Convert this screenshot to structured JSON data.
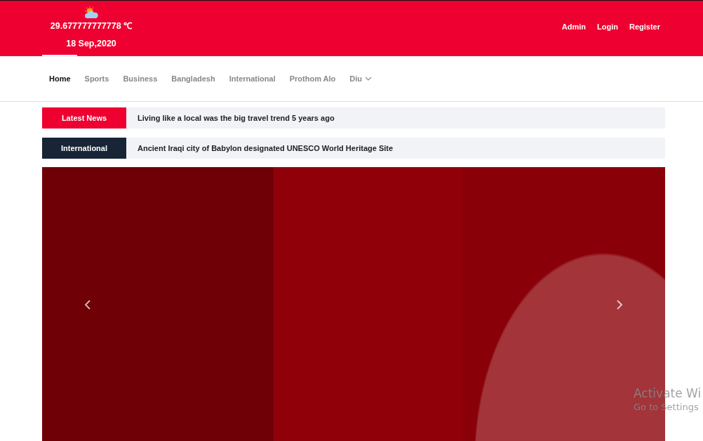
{
  "header": {
    "weather": {
      "temperature": "29.677777777778",
      "unit": "℃",
      "date": "18 Sep,2020"
    },
    "links": [
      "Admin",
      "Login",
      "Register"
    ]
  },
  "nav": {
    "items": [
      {
        "label": "Home",
        "selected": true,
        "dropdown": false
      },
      {
        "label": "Sports",
        "selected": false,
        "dropdown": false
      },
      {
        "label": "Business",
        "selected": false,
        "dropdown": false
      },
      {
        "label": "Bangladesh",
        "selected": false,
        "dropdown": false
      },
      {
        "label": "International",
        "selected": false,
        "dropdown": false
      },
      {
        "label": "Prothom Alo",
        "selected": false,
        "dropdown": false
      },
      {
        "label": "Diu",
        "selected": false,
        "dropdown": true
      }
    ]
  },
  "tickers": [
    {
      "label": "Latest News",
      "color": "#ee0030",
      "headline": "Living like a local was the big travel trend 5 years ago"
    },
    {
      "label": "International",
      "color": "#172536",
      "headline": "Ancient Iraqi city of Babylon designated UNESCO World Heritage Site"
    }
  ],
  "activation_notice": {
    "title": "Activate Wi",
    "subtitle": "Go to Settings"
  }
}
